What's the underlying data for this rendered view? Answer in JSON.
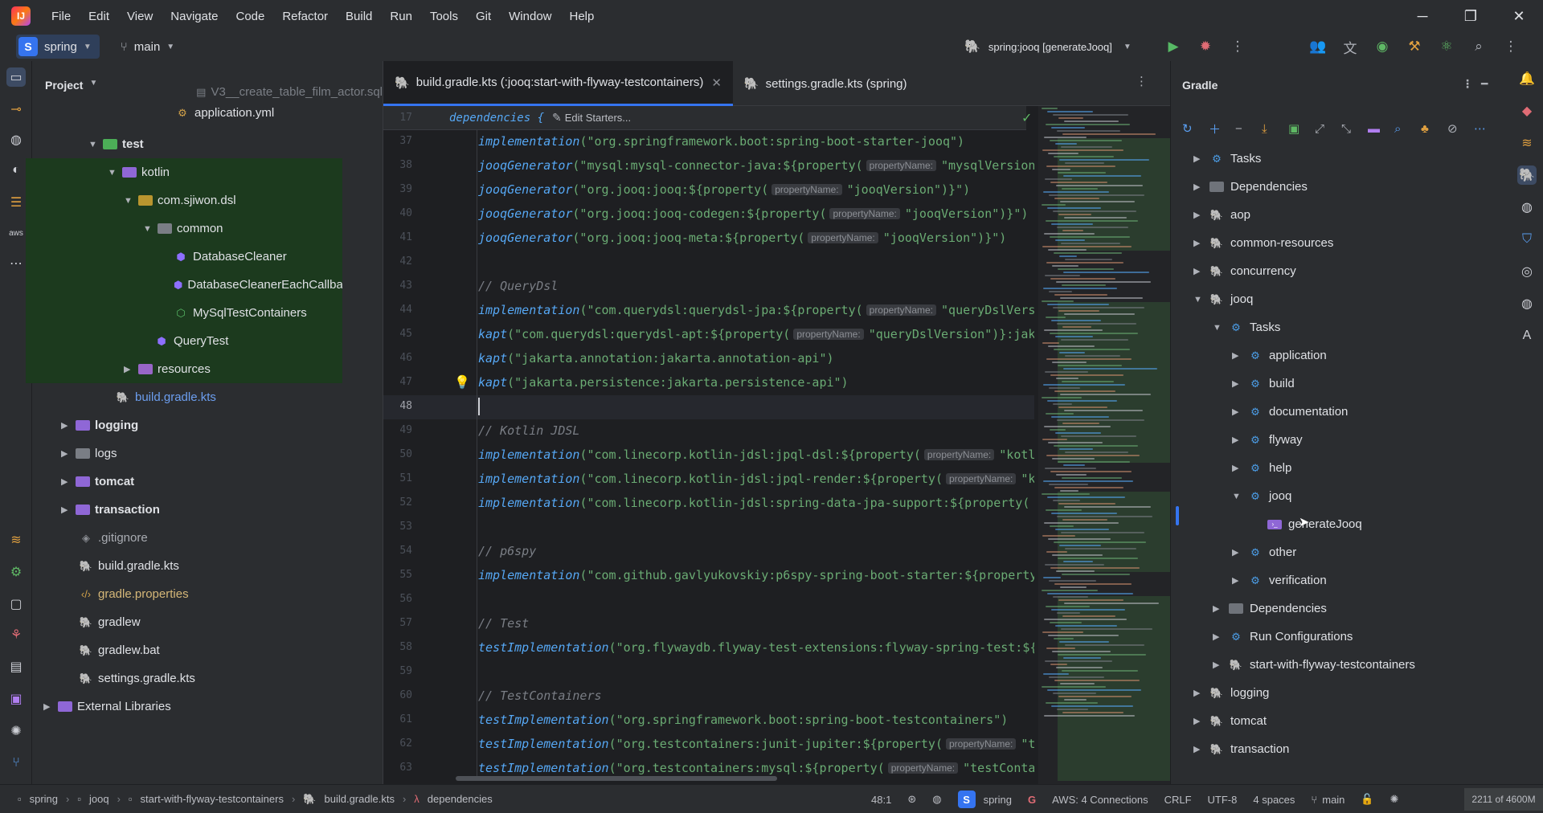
{
  "menu": [
    "File",
    "Edit",
    "View",
    "Navigate",
    "Code",
    "Refactor",
    "Build",
    "Run",
    "Tools",
    "Git",
    "Window",
    "Help"
  ],
  "toolbar": {
    "project_badge": "S",
    "project_name": "spring",
    "branch": "main",
    "run_config": "spring:jooq [generateJooq]"
  },
  "project_panel": {
    "title": "Project",
    "items": [
      {
        "label": "V3__create_table_film_actor.sql",
        "type": "sql"
      },
      {
        "label": "application.yml",
        "type": "yml"
      },
      {
        "label": "test",
        "type": "tfolder"
      },
      {
        "label": "kotlin",
        "type": "kfolder"
      },
      {
        "label": "com.sjiwon.dsl",
        "type": "folder"
      },
      {
        "label": "common",
        "type": "gfolder"
      },
      {
        "label": "DatabaseCleaner",
        "type": "kt"
      },
      {
        "label": "DatabaseCleanerEachCallback",
        "type": "kt"
      },
      {
        "label": "MySqlTestContainers",
        "type": "ktg"
      },
      {
        "label": "QueryTest",
        "type": "kt"
      },
      {
        "label": "resources",
        "type": "rfolder"
      },
      {
        "label": "build.gradle.kts",
        "type": "gradle"
      },
      {
        "label": "logging",
        "type": "kfolder"
      },
      {
        "label": "logs",
        "type": "gfolder"
      },
      {
        "label": "tomcat",
        "type": "kfolder"
      },
      {
        "label": "transaction",
        "type": "kfolder"
      },
      {
        "label": ".gitignore",
        "type": "git"
      },
      {
        "label": "build.gradle.kts",
        "type": "gradle"
      },
      {
        "label": "gradle.properties",
        "type": "props"
      },
      {
        "label": "gradlew",
        "type": "gradlew"
      },
      {
        "label": "gradlew.bat",
        "type": "gradlew"
      },
      {
        "label": "settings.gradle.kts",
        "type": "gradle"
      },
      {
        "label": "External Libraries",
        "type": "lib"
      }
    ]
  },
  "editor": {
    "tabs": [
      {
        "label": "build.gradle.kts (:jooq:start-with-flyway-testcontainers)",
        "active": true
      },
      {
        "label": "settings.gradle.kts (spring)",
        "active": false
      }
    ],
    "sticky": {
      "line": "17",
      "text": "dependencies {",
      "action": "Edit Starters..."
    },
    "hint_label": "propertyName:",
    "lines": [
      {
        "n": "37",
        "fn": "implementation",
        "rest": "(\"org.springframework.boot:spring-boot-starter-jooq\")"
      },
      {
        "n": "38",
        "fn": "jooqGenerator",
        "rest": "(\"mysql:mysql-connector-java:${property(",
        "tail": "\"mysqlVersion"
      },
      {
        "n": "39",
        "fn": "jooqGenerator",
        "rest": "(\"org.jooq:jooq:${property(",
        "tail": "\"jooqVersion\")}\")"
      },
      {
        "n": "40",
        "fn": "jooqGenerator",
        "rest": "(\"org.jooq:jooq-codegen:${property(",
        "tail": "\"jooqVersion\")}\")"
      },
      {
        "n": "41",
        "fn": "jooqGenerator",
        "rest": "(\"org.jooq:jooq-meta:${property(",
        "tail": "\"jooqVersion\")}\")"
      },
      {
        "n": "42",
        "fn": "",
        "rest": ""
      },
      {
        "n": "43",
        "comment": "// QueryDsl"
      },
      {
        "n": "44",
        "fn": "implementation",
        "rest": "(\"com.querydsl:querydsl-jpa:${property(",
        "tail": "\"queryDslVers"
      },
      {
        "n": "45",
        "fn": "kapt",
        "rest": "(\"com.querydsl:querydsl-apt:${property(",
        "tail": "\"queryDslVersion\")}:jak"
      },
      {
        "n": "46",
        "fn": "kapt",
        "rest": "(\"jakarta.annotation:jakarta.annotation-api\")"
      },
      {
        "n": "47",
        "fn": "kapt",
        "rest": "(\"jakarta.persistence:jakarta.persistence-api\")"
      },
      {
        "n": "48",
        "fn": "",
        "rest": ""
      },
      {
        "n": "49",
        "comment": "// Kotlin JDSL"
      },
      {
        "n": "50",
        "fn": "implementation",
        "rest": "(\"com.linecorp.kotlin-jdsl:jpql-dsl:${property(",
        "tail": "\"kotl"
      },
      {
        "n": "51",
        "fn": "implementation",
        "rest": "(\"com.linecorp.kotlin-jdsl:jpql-render:${property(",
        "tail": "\"k"
      },
      {
        "n": "52",
        "fn": "implementation",
        "rest": "(\"com.linecorp.kotlin-jdsl:spring-data-jpa-support:${property("
      },
      {
        "n": "53",
        "fn": "",
        "rest": ""
      },
      {
        "n": "54",
        "comment": "// p6spy"
      },
      {
        "n": "55",
        "fn": "implementation",
        "rest": "(\"com.github.gavlyukovskiy:p6spy-spring-boot-starter:${property"
      },
      {
        "n": "56",
        "fn": "",
        "rest": ""
      },
      {
        "n": "57",
        "comment": "// Test"
      },
      {
        "n": "58",
        "fn": "testImplementation",
        "rest": "(\"org.flywaydb.flyway-test-extensions:flyway-spring-test:${"
      },
      {
        "n": "59",
        "fn": "",
        "rest": ""
      },
      {
        "n": "60",
        "comment": "// TestContainers"
      },
      {
        "n": "61",
        "fn": "testImplementation",
        "rest": "(\"org.springframework.boot:spring-boot-testcontainers\")"
      },
      {
        "n": "62",
        "fn": "testImplementation",
        "rest": "(\"org.testcontainers:junit-jupiter:${property(",
        "tail": "\"t"
      },
      {
        "n": "63",
        "fn": "testImplementation",
        "rest": "(\"org.testcontainers:mysql:${property(",
        "tail": "\"testConta"
      }
    ]
  },
  "gradle_panel": {
    "title": "Gradle",
    "items": [
      {
        "label": "Tasks",
        "type": "task"
      },
      {
        "label": "Dependencies",
        "type": "deps"
      },
      {
        "label": "aop",
        "type": "elephant"
      },
      {
        "label": "common-resources",
        "type": "elephant"
      },
      {
        "label": "concurrency",
        "type": "elephant"
      },
      {
        "label": "jooq",
        "type": "elephant"
      },
      {
        "label": "Tasks",
        "type": "task"
      },
      {
        "label": "application",
        "type": "task"
      },
      {
        "label": "build",
        "type": "task"
      },
      {
        "label": "documentation",
        "type": "task"
      },
      {
        "label": "flyway",
        "type": "task"
      },
      {
        "label": "help",
        "type": "task"
      },
      {
        "label": "jooq",
        "type": "task"
      },
      {
        "label": "generateJooq",
        "type": "run"
      },
      {
        "label": "other",
        "type": "task"
      },
      {
        "label": "verification",
        "type": "task"
      },
      {
        "label": "Dependencies",
        "type": "deps"
      },
      {
        "label": "Run Configurations",
        "type": "task"
      },
      {
        "label": "start-with-flyway-testcontainers",
        "type": "elephant"
      },
      {
        "label": "logging",
        "type": "elephant"
      },
      {
        "label": "tomcat",
        "type": "elephant"
      },
      {
        "label": "transaction",
        "type": "elephant"
      }
    ]
  },
  "statusbar": {
    "crumbs": [
      "spring",
      "jooq",
      "start-with-flyway-testcontainers",
      "build.gradle.kts",
      "dependencies"
    ],
    "position": "48:1",
    "project": "spring",
    "aws": "AWS: 4 Connections",
    "line_sep": "CRLF",
    "encoding": "UTF-8",
    "indent": "4 spaces",
    "branch": "main",
    "memory": "2211 of 4600M"
  },
  "colors": {
    "accent": "#3574f0",
    "bg": "#1e1f22",
    "panel": "#2b2d30",
    "string": "#6aab73",
    "function": "#56a8f5"
  }
}
